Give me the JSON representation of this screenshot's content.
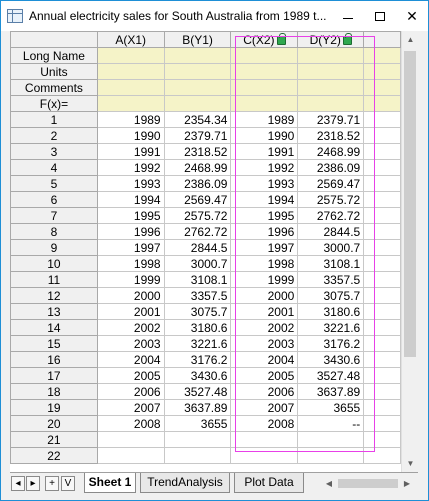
{
  "window": {
    "title": "Annual electricity sales for South Australia from 1989 t...",
    "minimize_glyph": "",
    "maximize_glyph": "",
    "close_glyph": "✕"
  },
  "columns": [
    {
      "label": "A(X1)",
      "locked": false
    },
    {
      "label": "B(Y1)",
      "locked": false
    },
    {
      "label": "C(X2)",
      "locked": true
    },
    {
      "label": "D(Y2)",
      "locked": true
    }
  ],
  "label_rows": [
    "Long Name",
    "Units",
    "Comments",
    "F(x)="
  ],
  "rows": [
    {
      "n": "1",
      "a": "1989",
      "b": "2354.34",
      "c": "1989",
      "d": "2379.71"
    },
    {
      "n": "2",
      "a": "1990",
      "b": "2379.71",
      "c": "1990",
      "d": "2318.52"
    },
    {
      "n": "3",
      "a": "1991",
      "b": "2318.52",
      "c": "1991",
      "d": "2468.99"
    },
    {
      "n": "4",
      "a": "1992",
      "b": "2468.99",
      "c": "1992",
      "d": "2386.09"
    },
    {
      "n": "5",
      "a": "1993",
      "b": "2386.09",
      "c": "1993",
      "d": "2569.47"
    },
    {
      "n": "6",
      "a": "1994",
      "b": "2569.47",
      "c": "1994",
      "d": "2575.72"
    },
    {
      "n": "7",
      "a": "1995",
      "b": "2575.72",
      "c": "1995",
      "d": "2762.72"
    },
    {
      "n": "8",
      "a": "1996",
      "b": "2762.72",
      "c": "1996",
      "d": "2844.5"
    },
    {
      "n": "9",
      "a": "1997",
      "b": "2844.5",
      "c": "1997",
      "d": "3000.7"
    },
    {
      "n": "10",
      "a": "1998",
      "b": "3000.7",
      "c": "1998",
      "d": "3108.1"
    },
    {
      "n": "11",
      "a": "1999",
      "b": "3108.1",
      "c": "1999",
      "d": "3357.5"
    },
    {
      "n": "12",
      "a": "2000",
      "b": "3357.5",
      "c": "2000",
      "d": "3075.7"
    },
    {
      "n": "13",
      "a": "2001",
      "b": "3075.7",
      "c": "2001",
      "d": "3180.6"
    },
    {
      "n": "14",
      "a": "2002",
      "b": "3180.6",
      "c": "2002",
      "d": "3221.6"
    },
    {
      "n": "15",
      "a": "2003",
      "b": "3221.6",
      "c": "2003",
      "d": "3176.2"
    },
    {
      "n": "16",
      "a": "2004",
      "b": "3176.2",
      "c": "2004",
      "d": "3430.6"
    },
    {
      "n": "17",
      "a": "2005",
      "b": "3430.6",
      "c": "2005",
      "d": "3527.48"
    },
    {
      "n": "18",
      "a": "2006",
      "b": "3527.48",
      "c": "2006",
      "d": "3637.89"
    },
    {
      "n": "19",
      "a": "2007",
      "b": "3637.89",
      "c": "2007",
      "d": "3655"
    },
    {
      "n": "20",
      "a": "2008",
      "b": "3655",
      "c": "2008",
      "d": "--"
    },
    {
      "n": "21",
      "a": "",
      "b": "",
      "c": "",
      "d": ""
    },
    {
      "n": "22",
      "a": "",
      "b": "",
      "c": "",
      "d": ""
    }
  ],
  "tabs": {
    "nav_first": "◂",
    "nav_next": "▸",
    "nav_add": "+",
    "nav_menu": "V",
    "items": [
      "Sheet 1",
      "TrendAnalysis",
      "Plot Data"
    ]
  },
  "colors": {
    "label_row_bg": "#f5f3c8",
    "highlight_box": "#e840e8",
    "lock_icon": "#2fa84f"
  }
}
